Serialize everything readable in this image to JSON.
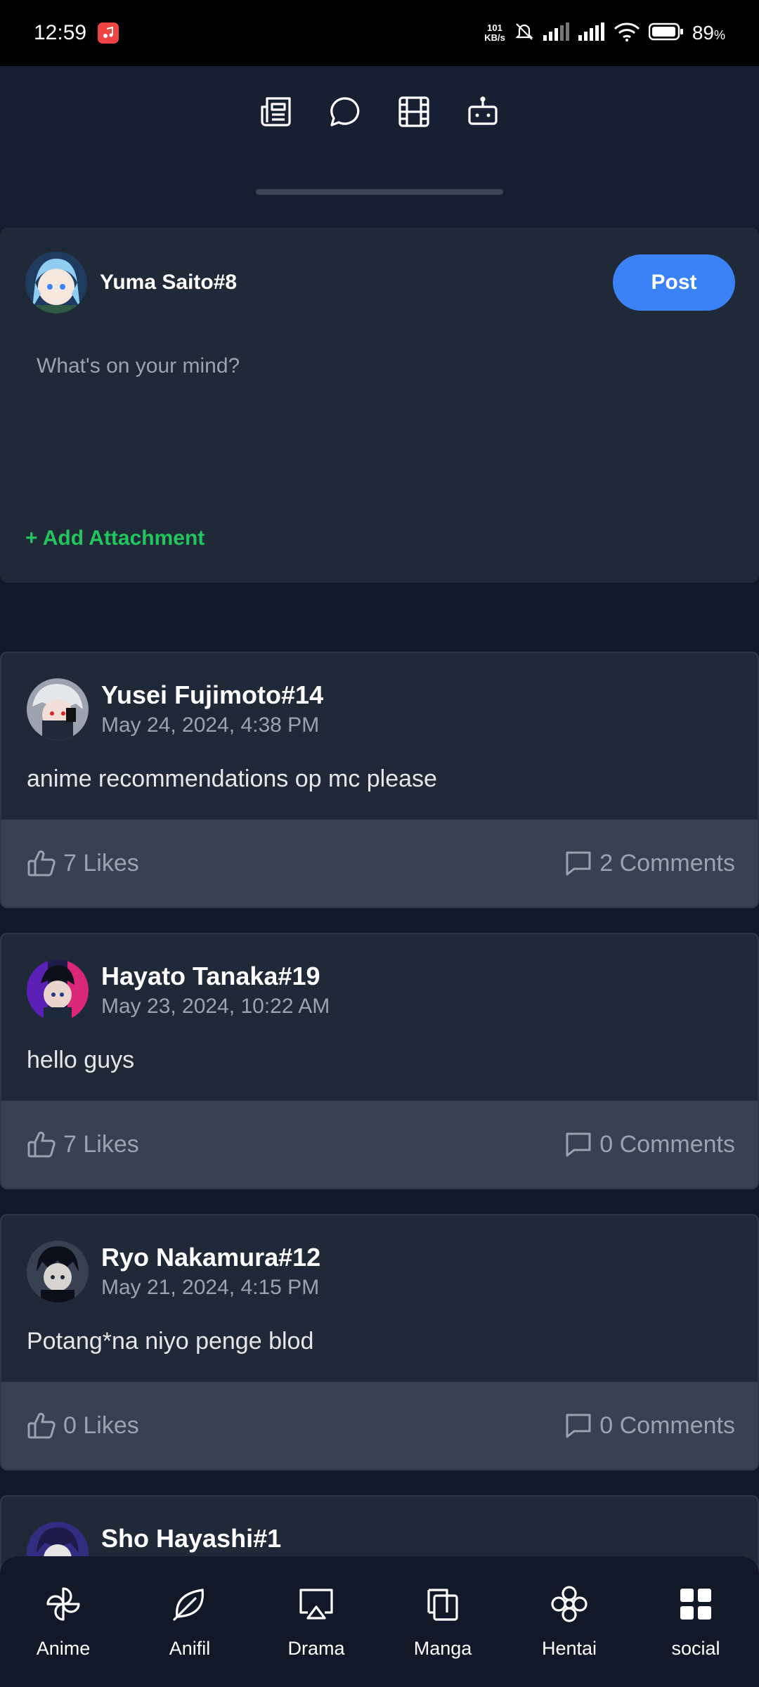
{
  "status_bar": {
    "time": "12:59",
    "net_speed_value": "101",
    "net_speed_unit": "KB/s",
    "battery_percent": "89",
    "battery_unit": "%"
  },
  "top_tabs": [
    {
      "name": "news-icon"
    },
    {
      "name": "chat-icon"
    },
    {
      "name": "film-icon"
    },
    {
      "name": "robot-icon"
    }
  ],
  "composer": {
    "user_name": "Yuma Saito#8",
    "post_label": "Post",
    "placeholder": "What's on your mind?",
    "attachment_label": "+ Add Attachment"
  },
  "posts": [
    {
      "author": "Yusei Fujimoto#14",
      "date": "May 24, 2024, 4:38 PM",
      "content": "anime recommendations op mc please",
      "likes": "7 Likes",
      "comments": "2 Comments"
    },
    {
      "author": "Hayato Tanaka#19",
      "date": "May 23, 2024, 10:22 AM",
      "content": "hello guys",
      "likes": "7 Likes",
      "comments": "0 Comments"
    },
    {
      "author": "Ryo Nakamura#12",
      "date": "May 21, 2024, 4:15 PM",
      "content": "Potang*na niyo penge blod",
      "likes": "0 Likes",
      "comments": "0 Comments"
    },
    {
      "author": "Sho Hayashi#1"
    }
  ],
  "bottom_nav": [
    {
      "label": "Anime",
      "icon": "pinwheel-icon"
    },
    {
      "label": "Anifil",
      "icon": "leaf-icon"
    },
    {
      "label": "Drama",
      "icon": "cast-icon"
    },
    {
      "label": "Manga",
      "icon": "book-icon"
    },
    {
      "label": "Hentai",
      "icon": "flower-icon"
    },
    {
      "label": "social",
      "icon": "grid-icon"
    }
  ],
  "colors": {
    "background": "#111827",
    "card": "#1f2937",
    "action_bar": "#374151",
    "accent": "#3b82f6",
    "attachment": "#22c55e"
  }
}
